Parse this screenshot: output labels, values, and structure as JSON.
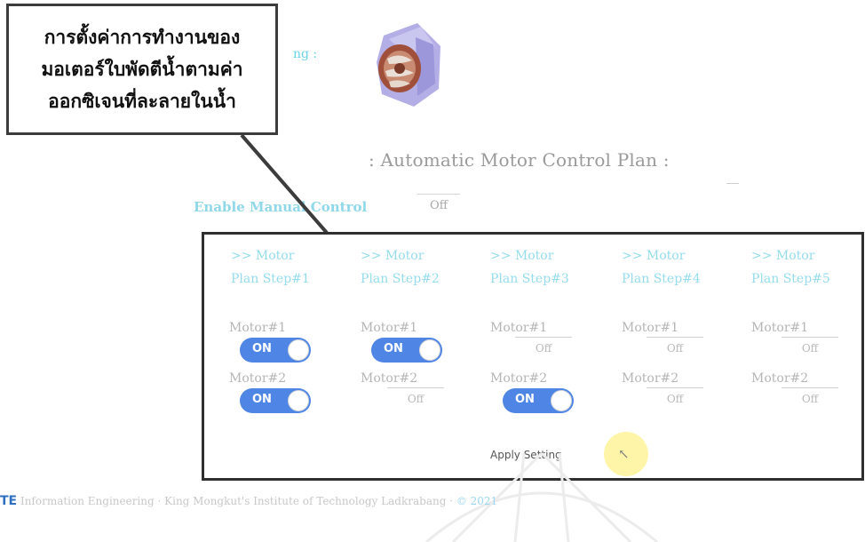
{
  "callout": {
    "lines": [
      "การตั้งค่าการทำงานของ",
      "มอเตอร์ใบพัดตีน้ำตามค่า",
      "ออกซิเจนที่ละลายในน้ำ"
    ]
  },
  "header": {
    "setting_label": "ng :",
    "plan_title": ": Automatic Motor Control Plan :"
  },
  "manual": {
    "label": "Enable Manual Control",
    "value": "Off"
  },
  "plan_steps": [
    {
      "title_line1": ">> Motor",
      "title_line2": "Plan Step#1",
      "motor1": {
        "label": "Motor#1",
        "state": "ON"
      },
      "motor2": {
        "label": "Motor#2",
        "state": "ON"
      }
    },
    {
      "title_line1": ">> Motor",
      "title_line2": "Plan Step#2",
      "motor1": {
        "label": "Motor#1",
        "state": "ON"
      },
      "motor2": {
        "label": "Motor#2",
        "state": "Off"
      }
    },
    {
      "title_line1": ">> Motor",
      "title_line2": "Plan Step#3",
      "motor1": {
        "label": "Motor#1",
        "state": "Off"
      },
      "motor2": {
        "label": "Motor#2",
        "state": "ON"
      }
    },
    {
      "title_line1": ">> Motor",
      "title_line2": "Plan Step#4",
      "motor1": {
        "label": "Motor#1",
        "state": "Off"
      },
      "motor2": {
        "label": "Motor#2",
        "state": "Off"
      }
    },
    {
      "title_line1": ">> Motor",
      "title_line2": "Plan Step#5",
      "motor1": {
        "label": "Motor#1",
        "state": "Off"
      },
      "motor2": {
        "label": "Motor#2",
        "state": "Off"
      }
    }
  ],
  "apply_label": "Apply Setting",
  "footer": {
    "logo": "TE",
    "text": "Information Engineering · King Mongkut's Institute of Technology Ladkrabang ·",
    "link": "© 2021"
  },
  "colors": {
    "accent_blue": "#4f86e6",
    "label_cyan": "#95dcec",
    "callout_border": "#3c3c3c"
  }
}
